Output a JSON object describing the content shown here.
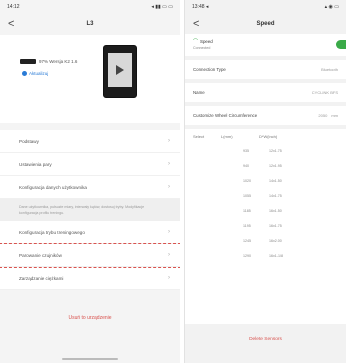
{
  "left": {
    "status": {
      "time": "14:12",
      "icons": "◂ ▮▮ ▭ ▭"
    },
    "nav": {
      "back": "<",
      "title": "L3"
    },
    "device": {
      "battery_text": "97%  Wersja K2 1.6",
      "update_text": "Aktualizuj"
    },
    "menu": [
      {
        "label": "Podstawy"
      },
      {
        "label": "Ustawienia pary"
      },
      {
        "label": "Konfiguracja danych użytkownika"
      }
    ],
    "hint": "Dane użytkownika, pułsuzłe miary, interwały kątów, dostosuj tryby. Modyfikacje konfiguracja profilu treningu.",
    "menu2": [
      {
        "label": "Konfiguracja trybu treningowego"
      },
      {
        "label": "Parowanie czujników"
      },
      {
        "label": "Zarządzanie ciężkami"
      }
    ],
    "reset": "Usuń to urządzenie",
    "highlight_color": "#d9534f"
  },
  "right": {
    "status": {
      "time": "13:48 ◂",
      "icons": "▴ ◉ ▭"
    },
    "nav": {
      "back": "<",
      "title": "Speed"
    },
    "sensor": {
      "name": "Speed",
      "status": "Connected",
      "toggle_color": "#3aaa48"
    },
    "rows": [
      {
        "label": "Connection Type",
        "value": "Bluetooth"
      },
      {
        "label": "Name",
        "value": "CYCLINK BFS"
      }
    ],
    "circ": {
      "label": "Customize Wheel Circumference",
      "value": "2050",
      "unit": "mm"
    },
    "table": {
      "headers": [
        "Select",
        "L(mm)",
        "D*W(inch)"
      ],
      "rows": [
        [
          "935",
          "12x1.75"
        ],
        [
          "940",
          "12x1.95"
        ],
        [
          "1020",
          "14x1.50"
        ],
        [
          "1055",
          "14x1.75"
        ],
        [
          "1185",
          "16x1.50"
        ],
        [
          "1195",
          "16x1.75"
        ],
        [
          "1245",
          "16x2.00"
        ],
        [
          "1290",
          "16x1-1/8"
        ]
      ]
    },
    "delete": "Delete Sensors"
  }
}
